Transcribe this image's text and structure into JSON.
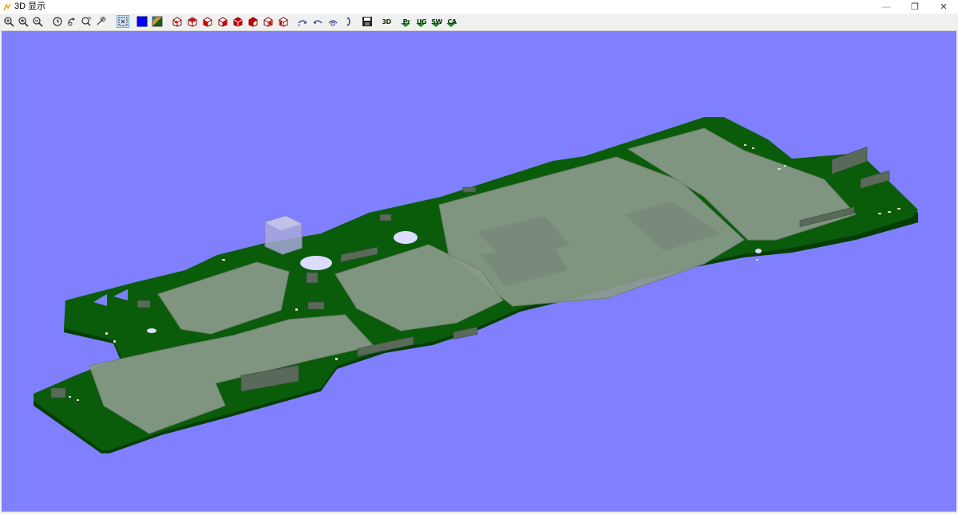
{
  "window": {
    "title": "3D 显示",
    "controls": {
      "minimize": "—",
      "restore": "❐",
      "close": "✕"
    }
  },
  "toolbar": {
    "text_buttons": {
      "view_3d": "3D",
      "export_pr": "Pr",
      "export_ug": "UG",
      "export_sw": "SW",
      "export_ca": "CA"
    }
  },
  "colors": {
    "viewport_background": "#8080ff",
    "pcb_board": "#0a5c0a",
    "shield_cans": "#8a9a8a"
  }
}
